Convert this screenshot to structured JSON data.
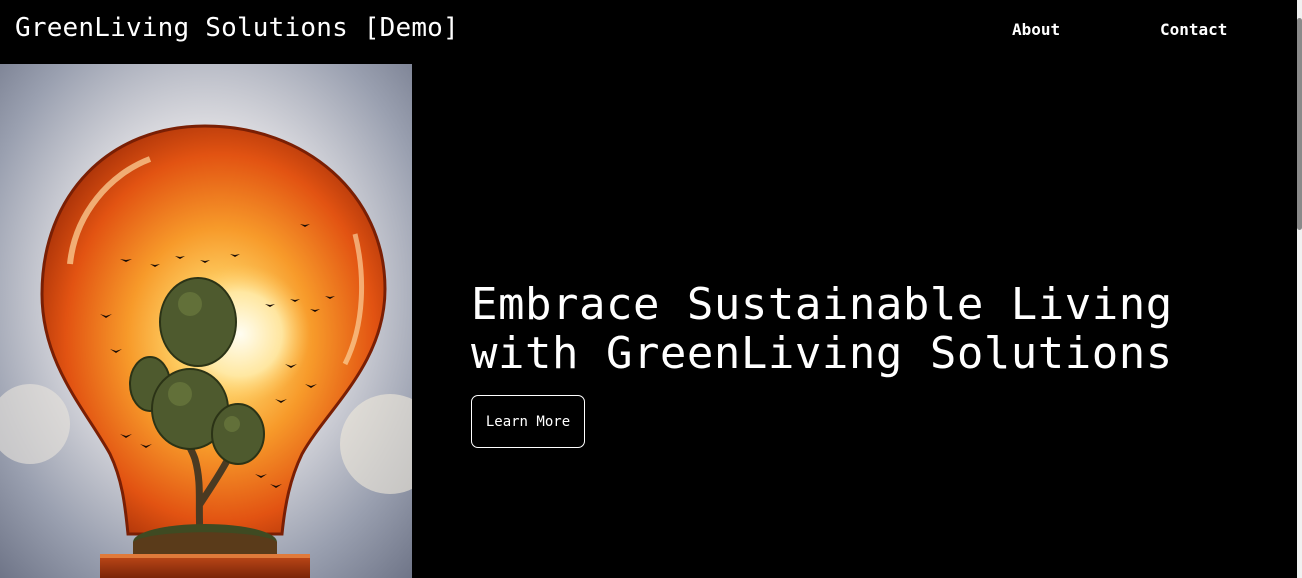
{
  "header": {
    "brand": "GreenLiving Solutions [Demo]",
    "nav": [
      {
        "label": "About"
      },
      {
        "label": "Contact"
      }
    ]
  },
  "hero": {
    "headline_line1": "Embrace Sustainable Living",
    "headline_line2": "with GreenLiving Solutions",
    "cta_label": "Learn More",
    "image_subject": "lightbulb-with-tree-and-birds"
  },
  "colors": {
    "background": "#000000",
    "text": "#ffffff",
    "bulb_orange": "#f26a1b",
    "bulb_glow": "#ffe7a0"
  }
}
